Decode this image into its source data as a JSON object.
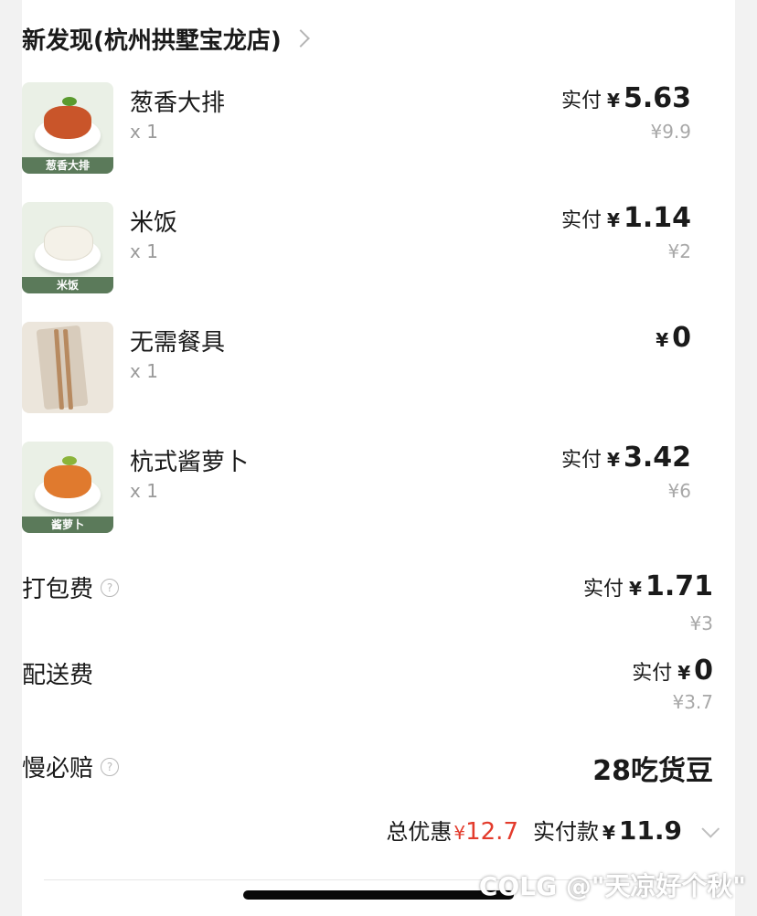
{
  "shop": {
    "title": "新发现(杭州拱墅宝龙店)"
  },
  "items": [
    {
      "name": "葱香大排",
      "qty": "x 1",
      "pay_label": "实付",
      "currency": "¥",
      "amount": "5.63",
      "original": "¥9.9",
      "thumb_tag": "葱香大排"
    },
    {
      "name": "米饭",
      "qty": "x 1",
      "pay_label": "实付",
      "currency": "¥",
      "amount": "1.14",
      "original": "¥2",
      "thumb_tag": "米饭"
    },
    {
      "name": "无需餐具",
      "qty": "x 1",
      "pay_label": "",
      "currency": "¥",
      "amount": "0",
      "original": ""
    },
    {
      "name": "杭式酱萝卜",
      "qty": "x 1",
      "pay_label": "实付",
      "currency": "¥",
      "amount": "3.42",
      "original": "¥6",
      "thumb_tag": "酱萝卜"
    }
  ],
  "fees": {
    "packaging": {
      "label": "打包费",
      "pay_label": "实付",
      "currency": "¥",
      "amount": "1.71",
      "original": "¥3"
    },
    "delivery": {
      "label": "配送费",
      "pay_label": "实付",
      "currency": "¥",
      "amount": "0",
      "original": "¥3.7"
    }
  },
  "compensation": {
    "label": "慢必赔",
    "value": "28吃货豆"
  },
  "summary": {
    "discount_label": "总优惠",
    "discount_currency": "¥",
    "discount_amount": "12.7",
    "total_label": "实付款",
    "total_currency": "¥",
    "total_amount": "11.9"
  },
  "watermark": "COLG @\"天凉好个秋\"",
  "colors": {
    "discount": "#e33b2c",
    "tag_bg": "#5b7a5a"
  }
}
